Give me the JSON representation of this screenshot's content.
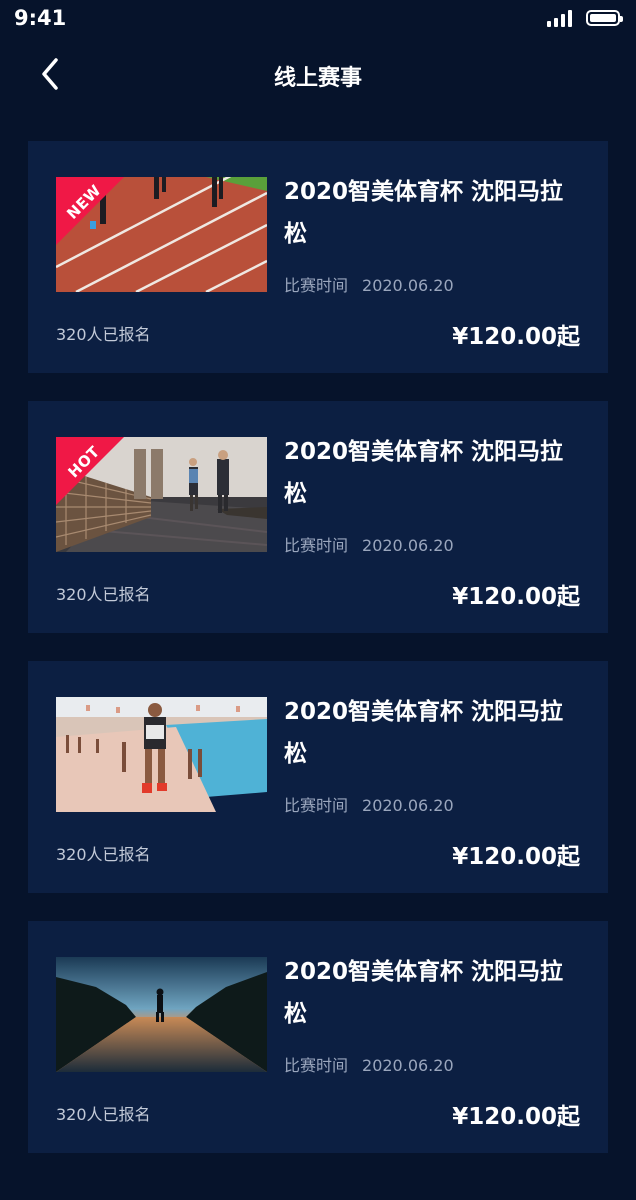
{
  "status_bar": {
    "time": "9:41"
  },
  "header": {
    "title": "线上赛事"
  },
  "events": [
    {
      "badge": "NEW",
      "title": "2020智美体育杯 沈阳马拉松",
      "date_label": "比赛时间",
      "date": "2020.06.20",
      "enrolled": "320人已报名",
      "price": "¥120.00起",
      "image": "track"
    },
    {
      "badge": "HOT",
      "title": "2020智美体育杯 沈阳马拉松",
      "date_label": "比赛时间",
      "date": "2020.06.20",
      "enrolled": "320人已报名",
      "price": "¥120.00起",
      "image": "bridge"
    },
    {
      "badge": "",
      "title": "2020智美体育杯 沈阳马拉松",
      "date_label": "比赛时间",
      "date": "2020.06.20",
      "enrolled": "320人已报名",
      "price": "¥120.00起",
      "image": "beach"
    },
    {
      "badge": "",
      "title": "2020智美体育杯 沈阳马拉松",
      "date_label": "比赛时间",
      "date": "2020.06.20",
      "enrolled": "320人已报名",
      "price": "¥120.00起",
      "image": "sunset-road"
    }
  ],
  "colors": {
    "background": "#06132b",
    "card": "#0c1f42",
    "badge": "#f01846"
  }
}
